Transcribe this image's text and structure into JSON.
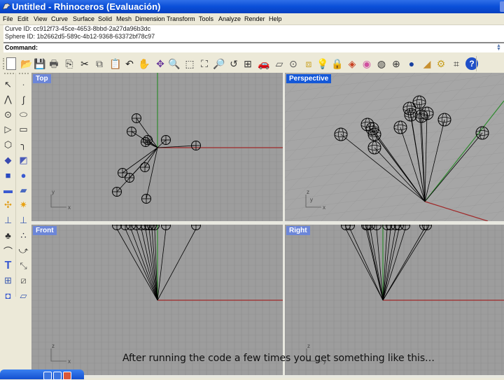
{
  "window": {
    "title": "Untitled - Rhinoceros (Evaluación)",
    "icon": "rhino-icon"
  },
  "menu": [
    "File",
    "Edit",
    "View",
    "Curve",
    "Surface",
    "Solid",
    "Mesh",
    "Dimension",
    "Transform",
    "Tools",
    "Analyze",
    "Render",
    "Help"
  ],
  "command_history": [
    "Curve ID: cc912f73-45ce-4653-8bbd-2a27da96b3dc",
    "Sphere ID: 1b2662d5-589c-4b12-9368-63372bf78c97"
  ],
  "command": {
    "label": "Command:",
    "value": ""
  },
  "toolbar": [
    {
      "name": "new-icon",
      "glyph": "🗋"
    },
    {
      "name": "open-icon",
      "glyph": "📂"
    },
    {
      "name": "save-icon",
      "glyph": "💾"
    },
    {
      "name": "print-icon",
      "glyph": "🖶"
    },
    {
      "name": "import-icon",
      "glyph": "⎘"
    },
    {
      "name": "cut-icon",
      "glyph": "✂"
    },
    {
      "name": "copy-icon",
      "glyph": "⧉"
    },
    {
      "name": "paste-icon",
      "glyph": "📋"
    },
    {
      "name": "undo-icon",
      "glyph": "↶"
    },
    {
      "name": "pan-icon",
      "glyph": "✋"
    },
    {
      "name": "rotate-view-icon",
      "glyph": "✥"
    },
    {
      "name": "zoom-dynamic-icon",
      "glyph": "🔍"
    },
    {
      "name": "zoom-window-icon",
      "glyph": "⬚"
    },
    {
      "name": "zoom-extents-icon",
      "glyph": "⛶"
    },
    {
      "name": "zoom-selected-icon",
      "glyph": "🔎"
    },
    {
      "name": "undo-view-icon",
      "glyph": "↺"
    },
    {
      "name": "four-viewports-icon",
      "glyph": "⊞"
    },
    {
      "name": "car-icon",
      "glyph": "🚗"
    },
    {
      "name": "grid-plane-icon",
      "glyph": "▱"
    },
    {
      "name": "osnap-icon",
      "glyph": "⊙"
    },
    {
      "name": "select-filter-icon",
      "glyph": "⧈"
    },
    {
      "name": "light-bulb-icon",
      "glyph": "💡"
    },
    {
      "name": "lock-icon",
      "glyph": "🔒"
    },
    {
      "name": "layer-icon",
      "glyph": "◈"
    },
    {
      "name": "color-wheel-icon",
      "glyph": "◉"
    },
    {
      "name": "wireframe-icon",
      "glyph": "◍"
    },
    {
      "name": "shaded-grid-icon",
      "glyph": "⊕"
    },
    {
      "name": "render-sphere-icon",
      "glyph": "●"
    },
    {
      "name": "light-icon",
      "glyph": "◢"
    },
    {
      "name": "options-gear-icon",
      "glyph": "⚙"
    },
    {
      "name": "history-icon",
      "glyph": "⌗"
    },
    {
      "name": "help-icon",
      "glyph": "?"
    }
  ],
  "left_tools": [
    {
      "name": "select-icon",
      "glyph": "↖"
    },
    {
      "name": "point-icon",
      "glyph": "·"
    },
    {
      "name": "polyline-icon",
      "glyph": "⋀"
    },
    {
      "name": "curve-icon",
      "glyph": "∫"
    },
    {
      "name": "circle-icon",
      "glyph": "⊙"
    },
    {
      "name": "ellipse-icon",
      "glyph": "⬭"
    },
    {
      "name": "polygon-icon",
      "glyph": "▷"
    },
    {
      "name": "rectangle-icon",
      "glyph": "▭"
    },
    {
      "name": "polygon-center-icon",
      "glyph": "⬡"
    },
    {
      "name": "fillet-curve-icon",
      "glyph": "╮"
    },
    {
      "name": "surface-points-icon",
      "glyph": "◆"
    },
    {
      "name": "surface-edge-icon",
      "glyph": "◩"
    },
    {
      "name": "box-icon",
      "glyph": "■"
    },
    {
      "name": "sphere-union-icon",
      "glyph": "●"
    },
    {
      "name": "cylinder-icon",
      "glyph": "▬"
    },
    {
      "name": "mesh-icon",
      "glyph": "▰"
    },
    {
      "name": "transform-icon",
      "glyph": "✣"
    },
    {
      "name": "explode-icon",
      "glyph": "✷"
    },
    {
      "name": "extend-icon",
      "glyph": "⊥"
    },
    {
      "name": "split-icon",
      "glyph": "⊥"
    },
    {
      "name": "boolean-icon",
      "glyph": "♣"
    },
    {
      "name": "group-icon",
      "glyph": "∴"
    },
    {
      "name": "arc-icon",
      "glyph": "⌒"
    },
    {
      "name": "rebuild-icon",
      "glyph": "⤻"
    },
    {
      "name": "text-icon",
      "glyph": "T"
    },
    {
      "name": "array-icon",
      "glyph": "⤡"
    },
    {
      "name": "block-icon",
      "glyph": "⊞"
    },
    {
      "name": "flow-icon",
      "glyph": "⧄"
    },
    {
      "name": "solid-box-icon",
      "glyph": "◘"
    },
    {
      "name": "dimension-icon",
      "glyph": "▱"
    }
  ],
  "viewports": {
    "top": {
      "label": "Top",
      "axis_a": "y",
      "axis_b": "x"
    },
    "perspective": {
      "label": "Perspective",
      "axis_a": "z",
      "axis_b": "y",
      "axis_c": "x"
    },
    "front": {
      "label": "Front",
      "axis_a": "z",
      "axis_b": "x"
    },
    "right": {
      "label": "Right",
      "axis_a": "z",
      "axis_b": "y"
    }
  },
  "colors": {
    "viewport_bg": "#9d9d9d",
    "grid": "#8f8f8f",
    "x_axis": "#a02828",
    "y_axis": "#2e8b2e",
    "active_label": "#1458d8",
    "inactive_label": "#6c86d8",
    "titlebar": "#0a4fd8"
  },
  "caption": "After running the code a few times you get something like this…"
}
